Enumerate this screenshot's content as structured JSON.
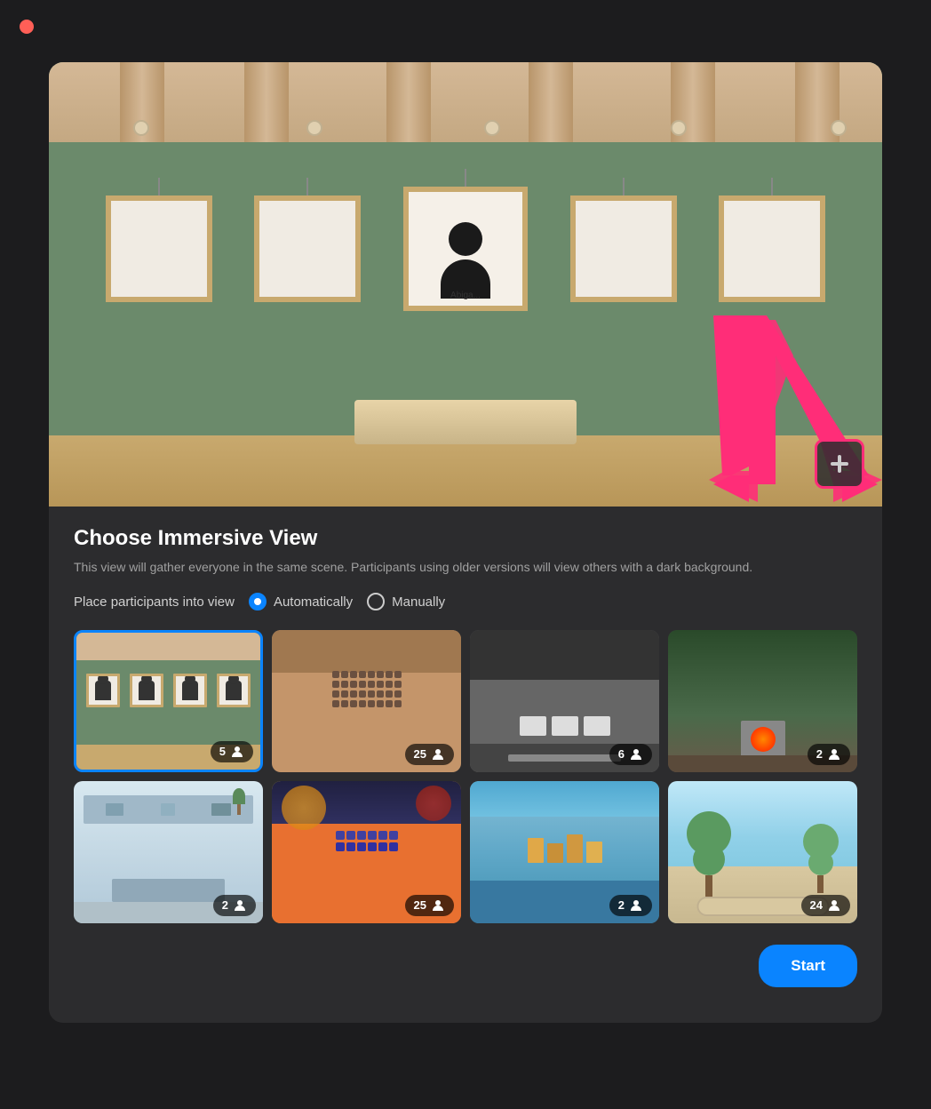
{
  "app": {
    "traffic_light_color": "#ff5f57"
  },
  "preview": {
    "person_name": "Abiga..."
  },
  "header": {
    "title": "Choose Immersive View",
    "description": "This view will gather everyone in the same scene. Participants using older versions will view others with a dark background.",
    "placement_label": "Place participants into view",
    "option_auto": "Automatically",
    "option_manual": "Manually",
    "selected_option": "auto"
  },
  "scenes": [
    {
      "id": "gallery",
      "count": 5,
      "selected": true
    },
    {
      "id": "auditorium",
      "count": 25,
      "selected": false
    },
    {
      "id": "modern",
      "count": 6,
      "selected": false
    },
    {
      "id": "fireplace",
      "count": 2,
      "selected": false
    },
    {
      "id": "office",
      "count": 2,
      "selected": false
    },
    {
      "id": "theater",
      "count": 25,
      "selected": false
    },
    {
      "id": "cafe",
      "count": 2,
      "selected": false
    },
    {
      "id": "nature",
      "count": 24,
      "selected": false
    }
  ],
  "footer": {
    "start_label": "Start"
  },
  "plus_button": {
    "label": "+"
  }
}
